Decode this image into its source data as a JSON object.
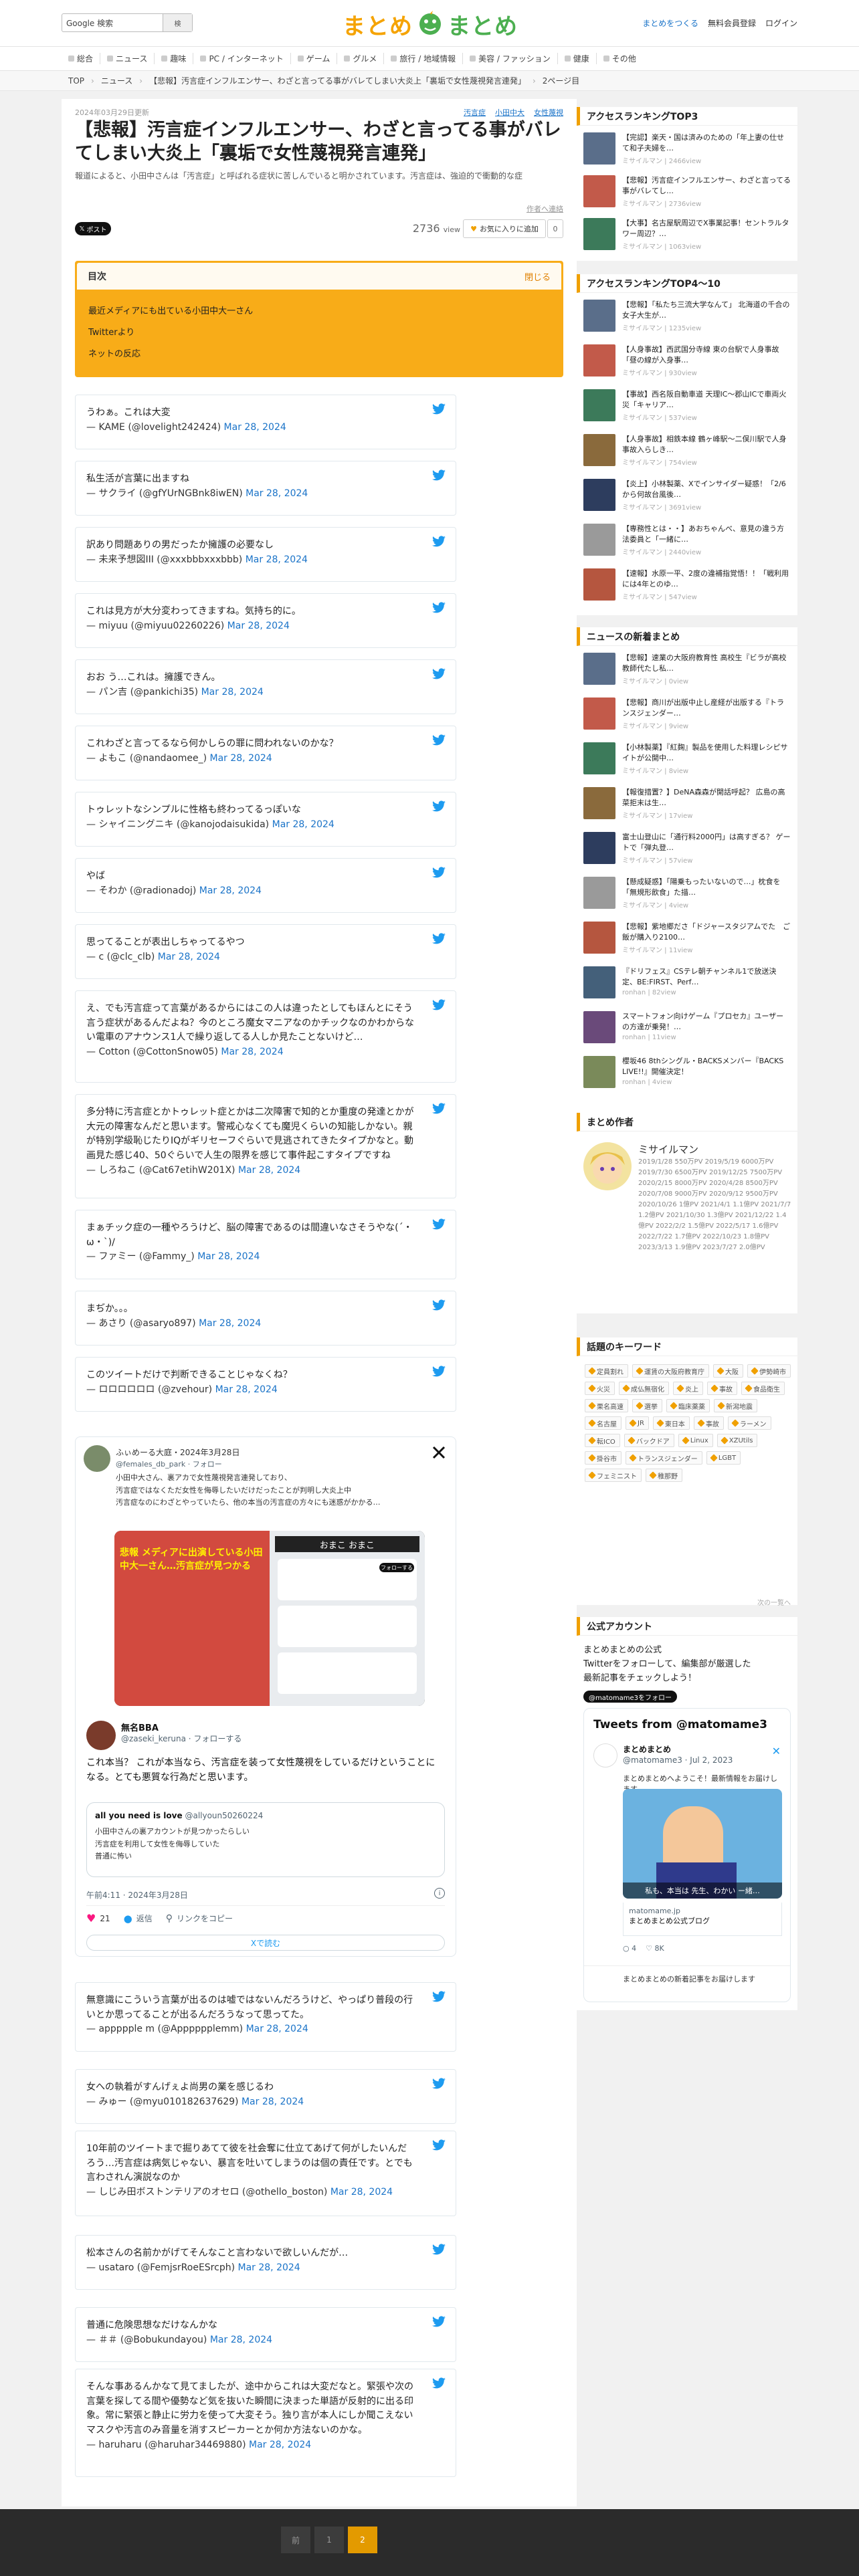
{
  "header": {
    "search_brand": "Google 検索",
    "search_placeholder": "",
    "search_button": "検",
    "logo_left": "まとめ",
    "logo_right": "まとめ",
    "links": [
      "まとめをつくる",
      "無料会員登録",
      "ログイン"
    ]
  },
  "category_nav": [
    "総合",
    "ニュース",
    "趣味",
    "PC / インターネット",
    "ゲーム",
    "グルメ",
    "旅行 / 地域情報",
    "美容 / ファッション",
    "健康",
    "その他"
  ],
  "breadcrumb": {
    "items": [
      "TOP",
      "ニュース",
      "【悲報】汚言症インフルエンサー、わざと言ってる事がバレてしまい大炎上「裏垢で女性蔑視発言連発」"
    ],
    "page": "2ページ目"
  },
  "article": {
    "date": "2024年03月29日更新",
    "tags": [
      "汚言症",
      "小田中大",
      "女性蔑視"
    ],
    "title": "【悲報】汚言症インフルエンサー、わざと言ってる事がバレてしまい大炎上「裏垢で女性蔑視発言連発」",
    "lede": "報道によると、小田中さんは「汚言症」と呼ばれる症状に苦しんでいると明かされています。汚言症は、強迫的で衝動的な症",
    "author_link": "作者へ連絡",
    "x_post": "ポスト",
    "views": "2736",
    "views_unit": "view",
    "fav_label": "お気に入りに追加",
    "fav_count": "0"
  },
  "toc": {
    "title": "目次",
    "close": "閉じる",
    "items": [
      "最近メディアにも出ている小田中大一さん",
      "Twitterより",
      "ネットの反応"
    ]
  },
  "tweets": [
    {
      "text": "うわぁ。これは大変",
      "by": "— KAME (@lovelight242424)",
      "date": "Mar 28, 2024"
    },
    {
      "text": "私生活が言葉に出ますね",
      "by": "— サクライ (@gfYUrNGBnk8iwEN)",
      "date": "Mar 28, 2024"
    },
    {
      "text": "訳あり問題ありの男だったか擁護の必要なし",
      "by": "— 未来予想図III (@xxxbbbxxxbbb)",
      "date": "Mar 28, 2024"
    },
    {
      "text": "これは見方が大分変わってきますね。気持ち的に。",
      "by": "— miyuu (@miyuu02260226)",
      "date": "Mar 28, 2024"
    },
    {
      "text": "おお う…これは。擁護できん。",
      "by": "— パン吉 (@pankichi35)",
      "date": "Mar 28, 2024"
    },
    {
      "text": "これわざと言ってるなら何かしらの罪に問われないのかな？",
      "by": "— よもこ (@nandaomee_)",
      "date": "Mar 28, 2024"
    },
    {
      "text": "トゥレットなシンプルに性格も終わってるっぽいな",
      "by": "— シャイニングニキ (@kanojodaisukida)",
      "date": "Mar 28, 2024"
    },
    {
      "text": "やば",
      "by": "— そわか (@radionadoj)",
      "date": "Mar 28, 2024"
    },
    {
      "text": "思ってることが表出しちゃってるやつ",
      "by": "— c (@clc_clb)",
      "date": "Mar 28, 2024"
    },
    {
      "text": "え、でも汚言症って言葉があるからにはこの人は違ったとしてもほんとにそう言う症状があるんだよね？今のところ魔女マニアなのかチックなのかわからない電車のアナウンス1人で繰り返してる人しか見たことないけど…",
      "by": "— Cotton (@CottonSnow05)",
      "date": "Mar 28, 2024"
    },
    {
      "text": "多分特に汚言症とかトゥレット症とかは二次障害で知的とか重度の発達とかが大元の障害なんだと思います。警戒心なくても魔児くらいの知能しかない。親が特別学級恥じたりIQがギリセーフぐらいで見逃されてきたタイプかなと。動画見た感じ40、50ぐらいで人生の限界を感じて事件起こすタイプですね",
      "by": "— しろねこ (@Cat67etihW201X)",
      "date": "Mar 28, 2024"
    },
    {
      "text": "まぁチック症の一種やろうけど、脳の障害であるのは間違いなさそうやな(´・ω・`)/",
      "by": "— ファミー (@Fammy_)",
      "date": "Mar 28, 2024"
    },
    {
      "text": "まぢか。。。",
      "by": "— あさり (@asaryo897)",
      "date": "Mar 28, 2024"
    },
    {
      "text": "このツイートだけで判断できることじゃなくね？",
      "by": "— ロロロロロロ (@zvehour)",
      "date": "Mar 28, 2024"
    }
  ],
  "embed": {
    "name": "ふぃめーる大庭・2024年3月28日",
    "handle": "@females_db_park · フォロー",
    "body": [
      "小田中大さん、裏アカで女性蔑視発言連発しており、",
      "汚言症ではなくただ女性を侮辱したいだけだったことが判明し大炎上中",
      "汚言症なのにわざとやっていたら、他の本当の汚言症の方々にも迷惑がかかる…"
    ],
    "image_caption_left": "悲報 メディアに出演している小田中大一さん…汚言症が見つかる",
    "image_caption_right": "おまこ  おまこ",
    "image_follow": "フォローする",
    "quote_name": "無名BBA",
    "quote_handle": "@zaseki_keruna · フォローする",
    "quote_text": "これ本当？ これが本当なら、汚言症を装って女性蔑視をしているだけということになる。とても悪質な行為だと思います。",
    "qq_name": "all you need is love",
    "qq_handle": "@allyoun50260224",
    "qq_text": [
      "小田中さんの裏アカウントが見つかったらしい",
      "汚言症を利用して女性を侮辱していた",
      "普通に怖い"
    ],
    "time": "午前4:11 · 2024年3月28日",
    "likes": "21",
    "reply": "返信",
    "copy": "リンクをコピー",
    "more": "Xで読む"
  },
  "tweets2": [
    {
      "text": "無意識にこういう言葉が出るのは嘘ではないんだろうけど、やっぱり普段の行いとか思ってることが出るんだろうなって思ってた。",
      "by": "— appppple m (@Apppppplemm)",
      "date": "Mar 28, 2024"
    },
    {
      "text": "女への執着がすんげぇよ尚男の業を感じるわ",
      "by": "— みゅー (@myu010182637629)",
      "date": "Mar 28, 2024"
    },
    {
      "text": "10年前のツイートまで掘りあてて彼を社会奪に仕立てあげて何がしたいんだろう…汚言症は病気じゃない、暴言を吐いてしまうのは個の責任です。とでも言わされん演説なのか",
      "by": "— しじみ田ボストンテリアのオセロ (@othello_boston)",
      "date": "Mar 28, 2024"
    },
    {
      "text": "松本さんの名前かがげてそんなこと言わないで欲しいんだが…",
      "by": "— usataro (@FemjsrRoeESrcph)",
      "date": "Mar 28, 2024"
    },
    {
      "text": "普通に危険思想なだけなんかな",
      "by": "— ＃＃ (@Bobukundayou)",
      "date": "Mar 28, 2024"
    },
    {
      "text": "そんな事あるんかなて見てましたが、途中からこれは大変だなと。緊張や次の言葉を探してる間や優勢など気を抜いた瞬間に決まった単語が反射的に出る印象。常に緊張と静止に労力を使って大変そう。独り言が本人にしか聞こえないマスクや汚言のみ音量を消すスピーカーとか何か方法ないのかな。",
      "by": "— haruharu (@haruhar34469880)",
      "date": "Mar 28, 2024"
    }
  ],
  "sidebar": {
    "rank_top3_title": "アクセスランキングTOP3",
    "rank_top3": [
      {
        "title": "【完認】楽天・国は済みのための「年上妻の仕せて和子夫婦を…",
        "author": "ミサイルマン | 2466view"
      },
      {
        "title": "【悲報】汚言症インフルエンサー、わざと言ってる事がバレてし…",
        "author": "ミサイルマン | 2736view"
      },
      {
        "title": "【大事】名古屋駅周辺でX事業記事！セントラルタワー周辺？…",
        "author": "ミサイルマン | 1063view"
      }
    ],
    "rank_4_10_title": "アクセスランキングTOP4〜10",
    "rank_4_10": [
      {
        "title": "【悲報】「私たち三流大学なんて」 北海道の千合の女子大生が…",
        "author": "ミサイルマン | 1235view"
      },
      {
        "title": "【人身事故】西武国分寺線 東の台駅で人身事故「昼の線が入身事…",
        "author": "ミサイルマン | 930view"
      },
      {
        "title": "【事故】西名阪自動車道 天理IC〜郡山ICで車両火災「キャリア…",
        "author": "ミサイルマン | 537view"
      },
      {
        "title": "【人身事故】相鉄本線 鶴ヶ峰駅〜二俣川駅で人身事故入らしき…",
        "author": "ミサイルマン | 754view"
      },
      {
        "title": "【炎上】小林製薬、Xでインサイダー疑惑！「2/6から何故台風後…",
        "author": "ミサイルマン | 3691view"
      },
      {
        "title": "【専務性とは・・】あおちゃんべ、意見の違う方法委員と「一緒に…",
        "author": "ミサイルマン | 2440view"
      },
      {
        "title": "【速報】水原一平、2度の違補指覚悟！！「戦利用には4年とのゆ…",
        "author": "ミサイルマン | 547view"
      }
    ],
    "news_title": "ニュースの新着まとめ",
    "news": [
      {
        "title": "【悲報】速業の大阪府教育性 高校生『ビラが高校教師代たし私…",
        "author": "ミサイルマン | 0view"
      },
      {
        "title": "【悲報】商川が出版中止し産経が出版する『トランスジェンダー…",
        "author": "ミサイルマン | 9view"
      },
      {
        "title": "【小林製薬】『紅麹』製品を使用した料理レシピサイトが公開中…",
        "author": "ミサイルマン | 8view"
      },
      {
        "title": "【報復措置？】DeNA森森が開話呼起？ 広島の高菜拒末は生…",
        "author": "ミサイルマン | 17view"
      },
      {
        "title": "富士山登山に「通行料2000円」は高すぎる？ ゲートで「弾丸登…",
        "author": "ミサイルマン | 57view"
      },
      {
        "title": "【懸成疑惑】「陽乗もったいないので…」枕食を「無規形飲食」た描…",
        "author": "ミサイルマン | 4view"
      },
      {
        "title": "【悲報】紫地郷ださ「ドジャースタジアムでた　ご飯が購入り2100…",
        "author": "ミサイルマン | 11view"
      },
      {
        "title": "『ドリフェス』CSテレ朝チャンネル1で放送決定、BE:FIRST、Perf…",
        "author": "ronhan | 82view"
      },
      {
        "title": "スマートフォン向けゲーム『プロセカ』ユーザーの方達が乗発！…",
        "author": "ronhan | 11view"
      },
      {
        "title": "櫻坂46 8thシングル・BACKSメンバー『BACKS LIVE!!』開催決定！",
        "author": "ronhan | 4view"
      }
    ],
    "author_title": "まとめ作者",
    "author_name": "ミサイルマン",
    "author_stats": "2019/1/28 550万PV 2019/5/19 6000万PV 2019/7/30 6500万PV 2019/12/25 7500万PV 2020/2/15 8000万PV 2020/4/28 8500万PV 2020/7/08 9000万PV 2020/9/12 9500万PV 2020/10/26 1億PV 2021/4/1 1.1億PV 2021/7/7 1.2億PV 2021/10/30 1.3億PV 2021/12/22 1.4億PV 2022/2/2 1.5億PV 2022/5/17 1.6億PV 2022/7/22 1.7億PV 2022/10/23 1.8億PV 2023/3/13 1.9億PV 2023/7/27 2.0億PV",
    "kw_title": "話題のキーワード",
    "keywords": [
      "定員割れ",
      "運賃の大阪府教育庁",
      "大阪",
      "伊勢崎市",
      "火災",
      "成仏無宿化",
      "炎上",
      "事故",
      "食品衛生",
      "栗名高速",
      "選挙",
      "臨床薬薬",
      "新潟地震",
      "名古屋",
      "JR",
      "東日本",
      "事故",
      "ラーメン",
      "転ICO",
      "バックドア",
      "Linux",
      "XZUtils",
      "掛谷市",
      "トランスジェンダー",
      "LGBT",
      "フェミニスト",
      "稚那野"
    ],
    "kw_more": "次の一覧へ",
    "official_title": "公式アカウント",
    "official_text": [
      "まとめまとめの公式",
      "Twitterをフォローして、編集部が厳選した",
      "最新記事をチェックしよう！"
    ],
    "follow_btn": "@matomame3をフォロー",
    "tl_title": "Tweets from @matomame3",
    "tl_name": "まとめまとめ",
    "tl_handle": "@matomame3 · Jul 2, 2023",
    "tl_text": "まとめまとめへようこそ！最新情報をお届けします",
    "tl_caption": "私も、本当は 先生、わかい ー緒…",
    "tl_url": "matomame.jp",
    "tl_url_text": "まとめまとめ公式ブログ",
    "tl_likes": "8K",
    "tl_replies": "4",
    "tl_next": "まとめまとめの新着記事をお届けします"
  },
  "footer": {
    "pages": [
      "前",
      "1",
      "2"
    ]
  },
  "colors": {
    "accent": "#f0a000",
    "link": "#1a73c8",
    "twitter": "#1d9bf0"
  }
}
